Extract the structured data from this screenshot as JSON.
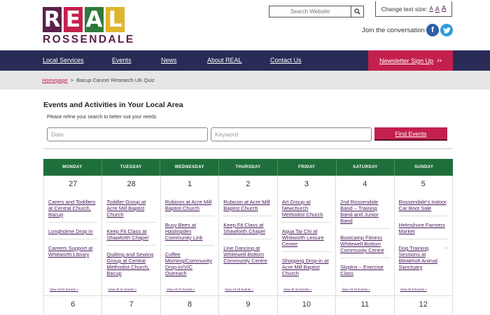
{
  "logo": {
    "letters": [
      "R",
      "E",
      "A",
      "L"
    ],
    "letter_colors": [
      "#5a2149",
      "#c4204d",
      "#2f7a3b",
      "#e0b52c"
    ],
    "subtitle": "ROSSENDALE"
  },
  "search": {
    "placeholder": "Search Website"
  },
  "text_size": {
    "label": "Change text size:",
    "sizes": [
      "A",
      "A",
      "A"
    ]
  },
  "social": {
    "label": "Join the conversation",
    "facebook": "f",
    "twitter": "t"
  },
  "nav": {
    "items": [
      "Local Services",
      "Events",
      "News",
      "About REAL",
      "Contact Us"
    ],
    "newsletter": "Newsletter Sign Up",
    "newsletter_chevron": "»"
  },
  "breadcrumb": {
    "home": "Homepage",
    "separator": ">",
    "current": "Bacup Cancer Research UK Quiz"
  },
  "events": {
    "title": "Events and Activities in Your Local Area",
    "subtitle": "Please refine your search to better suit your needs",
    "date_placeholder": "Date",
    "keyword_placeholder": "Keyword",
    "find_button": "Find Events"
  },
  "calendar": {
    "days": [
      "MONDAY",
      "TUESDAY",
      "WEDNESDAY",
      "THURSDAY",
      "FRIDAY",
      "SATURDAY",
      "SUNDAY"
    ],
    "week1": [
      {
        "num": "27",
        "events": [
          "Carers and Toddlers at Central Church, Bacup",
          "Longholme Drop In",
          "Careers Support at Whitworth Library"
        ],
        "view_all": "View All 31 Events »"
      },
      {
        "num": "28",
        "events": [
          "Toddler Group at Acre Mill Baptist Church",
          "Keep Fit Class at Shawforth Chapel",
          "Quilting and Sewing Group at Central Methodist Church, Bacup"
        ],
        "view_all": "View All 31 Events »"
      },
      {
        "num": "1",
        "events": [
          "Rubicon at Acre Mill Baptist Church",
          "Busy Bees at Haslingden Community Link",
          "Coffee Morning/Community Drop-in/VIC Outreach"
        ],
        "view_all": "View All 27 Events »"
      },
      {
        "num": "2",
        "events": [
          "Rubicon at Acre Mill Baptist Church",
          "Keep Fit Class at Shawforth Chapel",
          "Line Dancing at Whitewell Bottom Community Centre"
        ],
        "view_all": "View All 19 Events »"
      },
      {
        "num": "3",
        "events": [
          "Art Group at Newchurch Methodist Church",
          "Aqua Tai Chi at Whitworth Leisure Centre",
          "Shopping Drop-in at Acre Mill Baptist Church"
        ],
        "view_all": "View All 16 Events »"
      },
      {
        "num": "4",
        "events": [
          "2nd Rossendale Band – Training Band and Junior Band",
          "Bootcamp Fitness Whitewell Bottom Community Centre",
          "Skiptrix – Exercise Class"
        ],
        "view_all": "View All 15 Events »"
      },
      {
        "num": "5",
        "events": [
          "Rossendale's Indoor Car Boot Sale",
          "Helmshore Farmers Market",
          "Dog Training Sessions at Bleakholt Animal Sanctuary"
        ],
        "view_all": "View All 5 Events »"
      }
    ],
    "week2": [
      "6",
      "7",
      "8",
      "9",
      "10",
      "11",
      "12"
    ]
  },
  "colors": {
    "nav_bg": "#282c57",
    "accent": "#c4204d",
    "calendar_header": "#1f6f3b",
    "link": "#4a1d5e"
  }
}
